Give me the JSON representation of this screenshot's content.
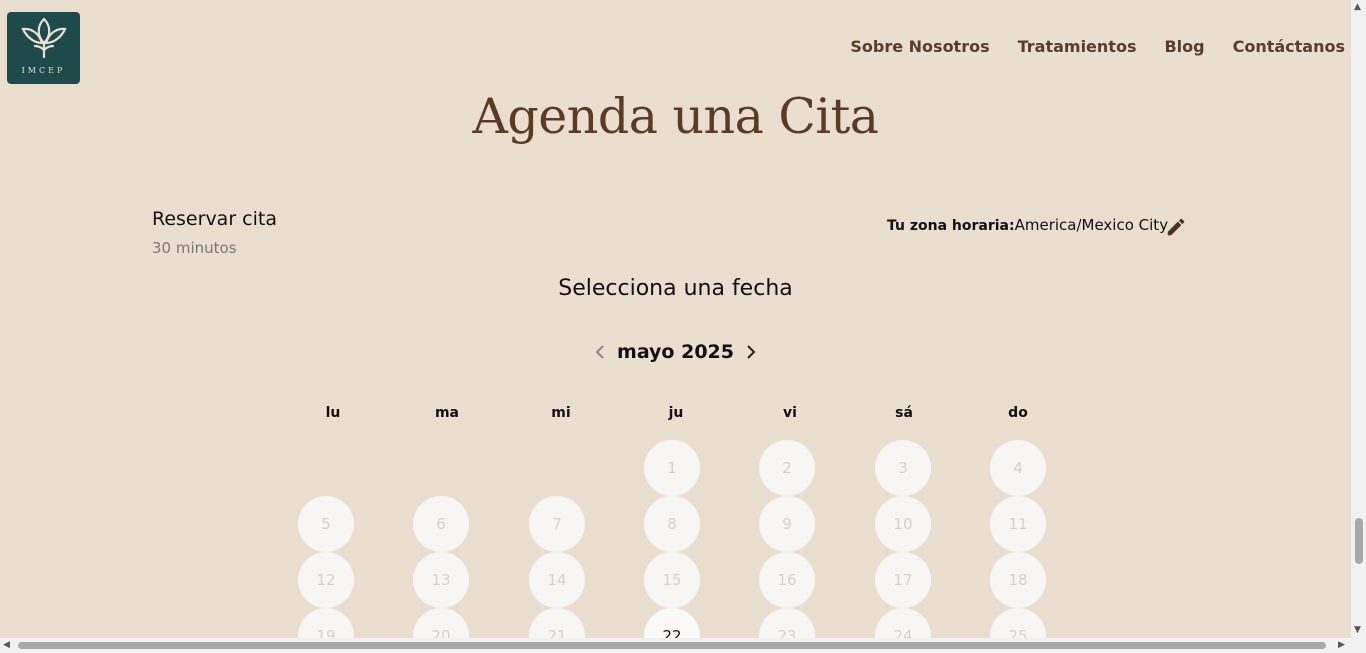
{
  "logo": {
    "text": "IMCEP"
  },
  "nav": {
    "items": [
      "Sobre Nosotros",
      "Tratamientos",
      "Blog",
      "Contáctanos"
    ]
  },
  "page": {
    "title": "Agenda una Cita"
  },
  "service": {
    "name": "Reservar cita",
    "duration": "30 minutos"
  },
  "timezone": {
    "label": "Tu zona horaria:",
    "value": "America/Mexico City"
  },
  "calendar": {
    "heading": "Selecciona una fecha",
    "month": "mayo 2025",
    "weekdays": [
      "lu",
      "ma",
      "mi",
      "ju",
      "vi",
      "sá",
      "do"
    ],
    "days": [
      "1",
      "2",
      "3",
      "4",
      "5",
      "6",
      "7",
      "8",
      "9",
      "10",
      "11",
      "12",
      "13",
      "14",
      "15",
      "16",
      "17",
      "18",
      "19",
      "20",
      "21",
      "22",
      "23",
      "24",
      "25"
    ],
    "available_days": [
      "22"
    ]
  },
  "colors": {
    "background": "#eadfce",
    "brand_dark": "#1f4a4c",
    "title_brown": "#5a3b26",
    "nav_brown": "#5a3d2a"
  },
  "icons": [
    "leaf-logo-icon",
    "edit-pencil-icon",
    "chevron-left-icon",
    "chevron-right-icon"
  ]
}
